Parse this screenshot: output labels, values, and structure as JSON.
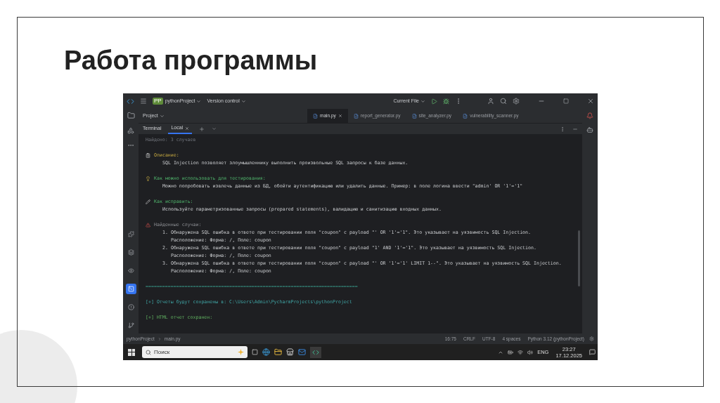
{
  "slide": {
    "title": "Работа программы"
  },
  "ide": {
    "toolbar": {
      "project_badge": "PP",
      "project": "pythonProject",
      "vcs": "Version control",
      "run_config": "Current File"
    },
    "project_panel": "Project",
    "editor_tabs": [
      {
        "label": "main.py",
        "selected": true
      },
      {
        "label": "report_generator.py",
        "selected": false
      },
      {
        "label": "site_analyzer.py",
        "selected": false
      },
      {
        "label": "vulnerability_scanner.py",
        "selected": false
      }
    ],
    "left_tools": [
      {
        "selected": false
      },
      {
        "selected": false
      },
      {
        "selected": false
      },
      {
        "selected": true
      },
      {
        "selected": false
      },
      {
        "selected": false
      }
    ],
    "terminal": {
      "title": "Terminal",
      "tabs": [
        {
          "label": "Local",
          "selected": true
        }
      ],
      "blocks": [
        [
          {
            "kind": "muted",
            "text": "Найдено: 3 случаев"
          }
        ],
        [
          {
            "kind": "note-heading",
            "text": "Описание:"
          },
          {
            "kind": "text",
            "text": "SQL Injection позволяет злоумышленнику выполнить произвольные SQL запросы к базе данных."
          }
        ],
        [
          {
            "kind": "idea-heading",
            "text": "Как можно использовать для тестирования:"
          },
          {
            "kind": "text",
            "text": "Можно попробовать извлечь данные из БД, обойти аутентификацию или удалить данные. Пример: в поле логина ввести \"admin' OR '1'='1\""
          }
        ],
        [
          {
            "kind": "fix-heading",
            "text": "Как исправить:"
          },
          {
            "kind": "text",
            "text": "Используйте параметризованные запросы (prepared statements), валидацию и санитизацию входных данных."
          }
        ],
        [
          {
            "kind": "alert-heading",
            "text": "Найденные случаи:"
          },
          {
            "kind": "item",
            "text": "1. Обнаружена SQL ошибка в ответе при тестировании поля \"coupon\" с payload \"' OR '1'='1\". Это указывает на уязвимость SQL Injection."
          },
          {
            "kind": "item",
            "text": "   Расположение: Форма: /, Поле: coupon"
          },
          {
            "kind": "item",
            "text": "2. Обнаружена SQL ошибка в ответе при тестировании поля \"coupon\" с payload \"1' AND '1'='1\". Это указывает на уязвимость SQL Injection."
          },
          {
            "kind": "item",
            "text": "   Расположение: Форма: /, Поле: coupon"
          },
          {
            "kind": "item",
            "text": "3. Обнаружена SQL ошибка в ответе при тестировании поля \"coupon\" с payload \"' OR '1'='1' LIMIT 1--\". Это указывает на уязвимость SQL Injection."
          },
          {
            "kind": "item",
            "text": "   Расположение: Форма: /, Поле: coupon"
          }
        ],
        [
          {
            "kind": "divider",
            "text": "============================================================================"
          }
        ],
        [
          {
            "kind": "info",
            "text": "[+] Отчеты будут сохранены в: C:\\Users\\Admin\\PycharmProjects\\pythonProject"
          }
        ],
        [
          {
            "kind": "success",
            "text": "[+] HTML отчет сохранен:"
          }
        ]
      ]
    },
    "status_bar": {
      "breadcrumbs": [
        "pythonProject",
        "main.py"
      ],
      "items": [
        "16:75",
        "CRLF",
        "UTF-8",
        "4 spaces",
        "Python 3.12 (pythonProject)"
      ]
    }
  },
  "taskbar": {
    "search": {
      "placeholder": "Поиск"
    },
    "language": "ENG",
    "time": "23:27",
    "date": "17.12.2025"
  }
}
